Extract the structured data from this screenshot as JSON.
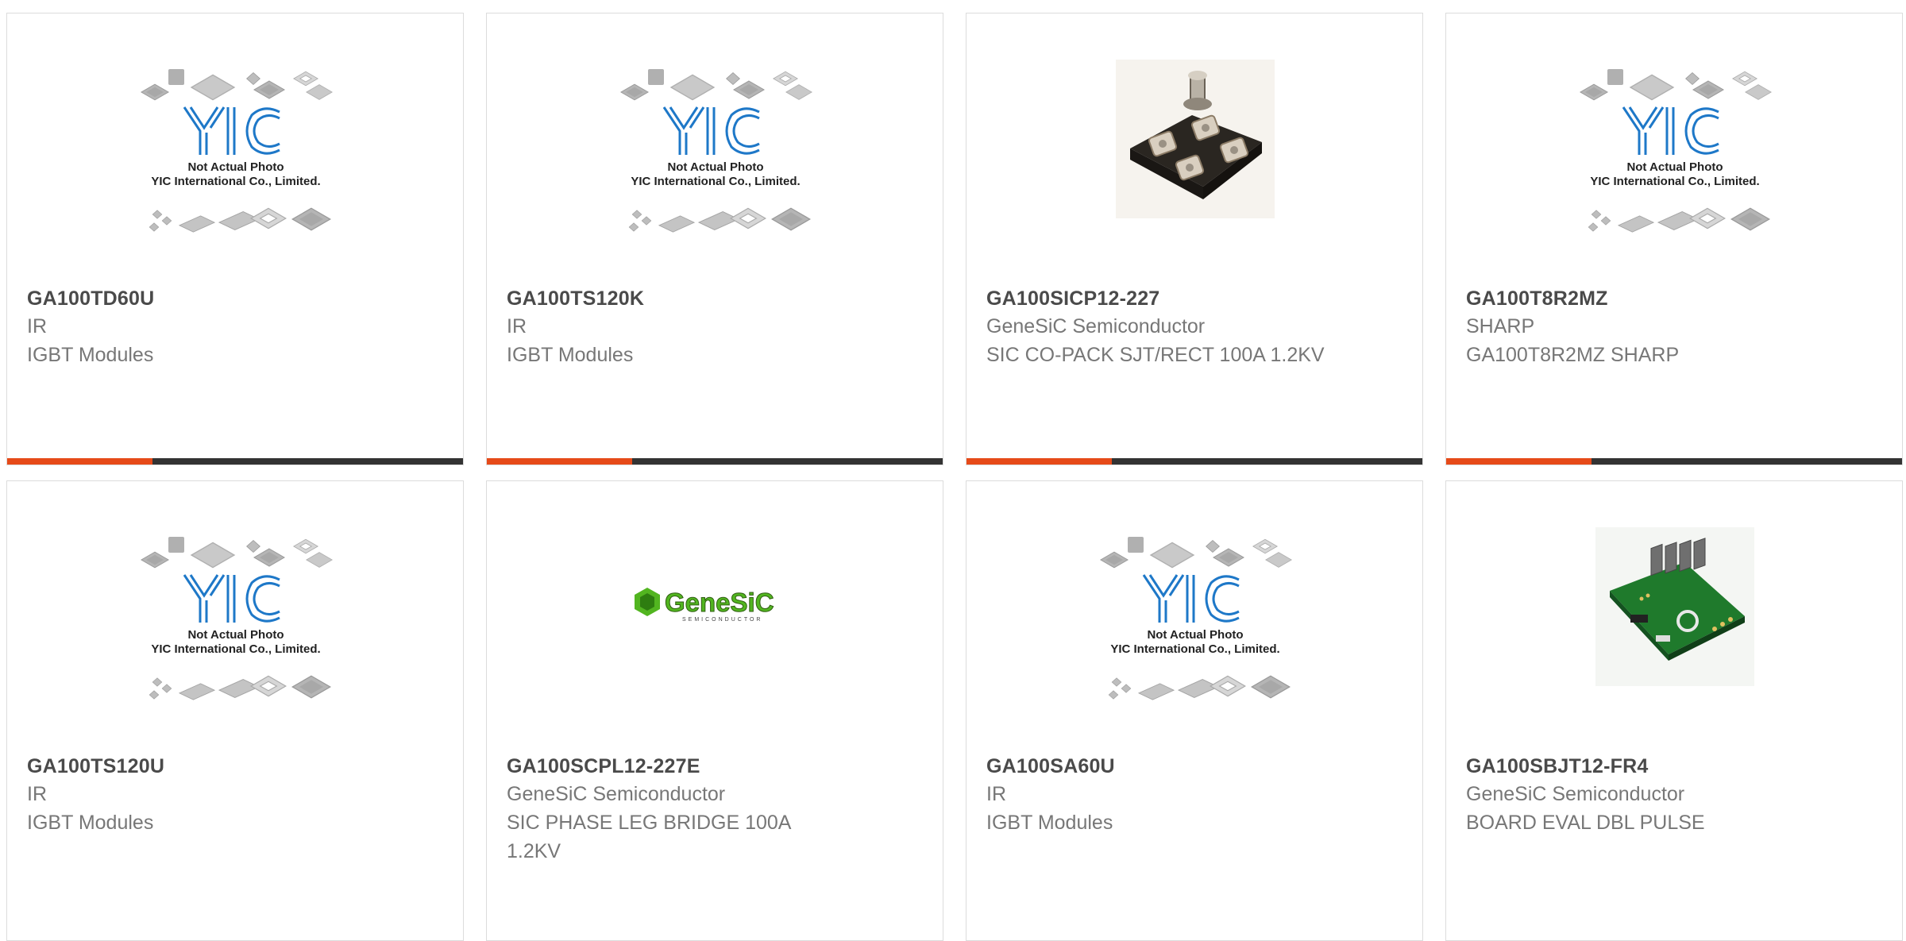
{
  "colors": {
    "card_border": "#dcdcdc",
    "title_text": "#4a4a4a",
    "body_text": "#777777",
    "bar_dark": "#333333",
    "bar_accent": "#e64a19",
    "yic_logo_blue": "#1e78c8",
    "genesic_green": "#52b520"
  },
  "placeholder": {
    "line1": "Not Actual Photo",
    "line2": "YIC International Co., Limited.",
    "logo_text": "YIC"
  },
  "genesic_logo": {
    "name": "GeneSiC",
    "tagline": "SEMICONDUCTOR"
  },
  "products": [
    {
      "part_number": "GA100TD60U",
      "manufacturer": "IR",
      "description": "IGBT Modules",
      "image": "yic-placeholder-image"
    },
    {
      "part_number": "GA100TS120K",
      "manufacturer": "IR",
      "description": "IGBT Modules",
      "image": "yic-placeholder-image"
    },
    {
      "part_number": "GA100SICP12-227",
      "manufacturer": "GeneSiC Semiconductor",
      "description": "SIC CO-PACK SJT/RECT 100A 1.2KV",
      "image": "sot227-module-photo"
    },
    {
      "part_number": "GA100T8R2MZ",
      "manufacturer": "SHARP",
      "description": "GA100T8R2MZ SHARP",
      "image": "yic-placeholder-image"
    },
    {
      "part_number": "GA100TS120U",
      "manufacturer": "IR",
      "description": "IGBT Modules",
      "image": "yic-placeholder-image"
    },
    {
      "part_number": "GA100SCPL12-227E",
      "manufacturer": "GeneSiC Semiconductor",
      "description": "SIC PHASE LEG BRIDGE 100A 1.2KV",
      "image": "genesic-logo-image"
    },
    {
      "part_number": "GA100SA60U",
      "manufacturer": "IR",
      "description": "IGBT Modules",
      "image": "yic-placeholder-image"
    },
    {
      "part_number": "GA100SBJT12-FR4",
      "manufacturer": "GeneSiC Semiconductor",
      "description": "BOARD EVAL DBL PULSE",
      "image": "eval-board-photo"
    }
  ]
}
